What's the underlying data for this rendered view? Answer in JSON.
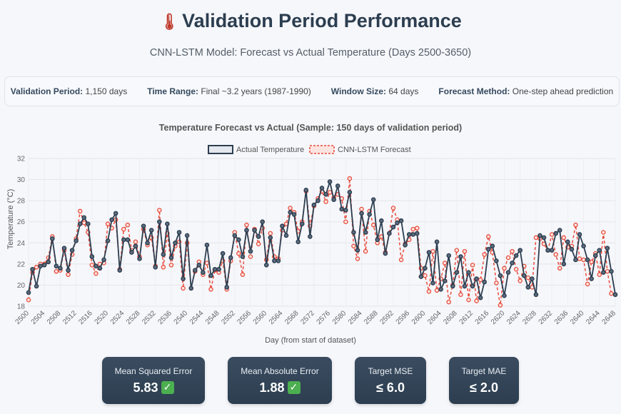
{
  "header": {
    "icon": "thermometer-icon",
    "title": "Validation Period Performance",
    "subtitle": "CNN-LSTM Model: Forecast vs Actual Temperature (Days 2500-3650)"
  },
  "info": {
    "validation_period_label": "Validation Period:",
    "validation_period_value": "1,150 days",
    "time_range_label": "Time Range:",
    "time_range_value": "Final ~3.2 years (1987-1990)",
    "window_size_label": "Window Size:",
    "window_size_value": "64 days",
    "forecast_method_label": "Forecast Method:",
    "forecast_method_value": "One-step ahead prediction"
  },
  "metrics": [
    {
      "label": "Mean Squared Error",
      "value": "5.83",
      "check": "✓"
    },
    {
      "label": "Mean Absolute Error",
      "value": "1.88",
      "check": "✓"
    },
    {
      "label": "Target MSE",
      "value": "≤ 6.0"
    },
    {
      "label": "Target MAE",
      "value": "≤ 2.0"
    }
  ],
  "colors": {
    "actual_line": "#2c3e50",
    "actual_point": "#5d6d7e",
    "forecast": "#e74c3c",
    "card": "#2c3e50",
    "check": "#4caf50"
  },
  "chart_data": {
    "type": "line",
    "title": "Temperature Forecast vs Actual (Sample: 150 days of validation period)",
    "xlabel": "Day (from start of dataset)",
    "ylabel": "Temperature (°C)",
    "ylim": [
      18,
      32
    ],
    "yticks": [
      18,
      20,
      22,
      24,
      26,
      28,
      30,
      32
    ],
    "grid": true,
    "legend": "top-center",
    "x_start": 2500,
    "x_step": 1,
    "xtick_labels": [
      "2500",
      "2504",
      "2508",
      "2512",
      "2516",
      "2520",
      "2524",
      "2528",
      "2532",
      "2536",
      "2540",
      "2544",
      "2548",
      "2552",
      "2556",
      "2560",
      "2564",
      "2568",
      "2572",
      "2576",
      "2580",
      "2584",
      "2588",
      "2592",
      "2596",
      "2600",
      "2604",
      "2608",
      "2612",
      "2616",
      "2620",
      "2624",
      "2628",
      "2632",
      "2636",
      "2640",
      "2644",
      "2648"
    ],
    "series": [
      {
        "name": "Actual Temperature",
        "values": [
          19.3,
          21.5,
          19.9,
          21.8,
          21.9,
          22.2,
          24.4,
          21.8,
          21.6,
          23.5,
          21.4,
          23.3,
          24.2,
          25.8,
          26.4,
          25.8,
          22.7,
          21.8,
          21.6,
          22.4,
          24.2,
          26.2,
          26.8,
          21.4,
          24.3,
          24.3,
          23.1,
          23.7,
          22.5,
          25.6,
          24.0,
          25.2,
          21.7,
          26.0,
          22.9,
          25.8,
          22.6,
          24.0,
          25.0,
          20.6,
          24.7,
          19.7,
          21.4,
          21.9,
          21.2,
          23.8,
          20.9,
          21.5,
          21.5,
          23.0,
          19.8,
          22.6,
          24.7,
          24.3,
          22.7,
          25.2,
          23.2,
          25.2,
          24.6,
          26.0,
          21.9,
          24.5,
          22.3,
          22.3,
          25.6,
          24.7,
          26.9,
          26.7,
          24.1,
          25.8,
          29.0,
          24.6,
          27.6,
          28.0,
          29.2,
          28.6,
          29.8,
          28.1,
          29.4,
          27.2,
          27.1,
          28.8,
          25.0,
          23.3,
          26.8,
          25.0,
          26.7,
          28.1,
          24.3,
          26.1,
          23.0,
          24.9,
          25.5,
          25.9,
          26.1,
          23.8,
          24.8,
          24.8,
          24.9,
          20.8,
          21.6,
          23.1,
          20.2,
          24.1,
          19.6,
          20.4,
          22.8,
          19.9,
          21.2,
          22.7,
          19.9,
          21.2,
          19.9,
          20.6,
          18.8,
          20.3,
          23.4,
          23.7,
          22.3,
          20.9,
          19.0,
          21.2,
          22.1,
          22.8,
          23.3,
          20.9,
          19.8,
          20.6,
          19.1,
          24.7,
          24.5,
          23.3,
          23.3,
          24.9,
          25.2,
          22.0,
          24.1,
          23.4,
          22.4,
          24.8,
          23.7,
          22.4,
          20.6,
          22.8,
          23.3,
          21.2,
          23.5,
          21.3,
          19.1
        ]
      },
      {
        "name": "CNN-LSTM Forecast",
        "values": [
          18.6,
          21.2,
          21.7,
          22.0,
          22.0,
          22.6,
          24.6,
          21.3,
          21.4,
          23.3,
          21.0,
          22.9,
          24.4,
          27.0,
          25.9,
          25.0,
          21.9,
          21.1,
          22.0,
          22.1,
          25.8,
          25.4,
          26.2,
          21.5,
          25.3,
          25.7,
          23.3,
          24.1,
          22.7,
          25.3,
          23.8,
          24.5,
          21.8,
          27.1,
          21.7,
          24.9,
          21.9,
          23.7,
          24.1,
          19.7,
          24.0,
          19.7,
          21.3,
          22.2,
          21.0,
          22.1,
          19.6,
          21.4,
          21.2,
          22.3,
          19.6,
          22.3,
          25.0,
          23.0,
          21.0,
          25.7,
          22.7,
          25.3,
          23.9,
          25.4,
          22.4,
          24.9,
          22.7,
          22.5,
          25.2,
          25.8,
          27.3,
          26.9,
          25.1,
          26.0,
          28.9,
          25.6,
          27.5,
          28.2,
          28.9,
          27.9,
          28.8,
          28.3,
          28.6,
          28.2,
          26.0,
          30.1,
          23.7,
          22.5,
          27.2,
          23.2,
          27.0,
          25.7,
          24.0,
          24.6,
          23.1,
          24.9,
          27.3,
          26.2,
          22.4,
          23.9,
          24.3,
          25.3,
          25.4,
          21.6,
          20.9,
          19.4,
          23.2,
          19.5,
          20.6,
          22.1,
          18.4,
          20.0,
          23.3,
          19.1,
          23.2,
          18.6,
          21.9,
          18.5,
          20.5,
          22.9,
          24.6,
          23.1,
          20.2,
          18.1,
          21.6,
          22.6,
          23.2,
          21.5,
          20.4,
          21.8,
          20.7,
          19.8,
          24.5,
          24.4,
          23.9,
          23.3,
          24.8,
          22.9,
          21.6,
          24.5,
          23.6,
          23.7,
          25.7,
          22.5,
          22.4,
          20.1,
          22.2,
          23.0,
          21.0,
          25.0,
          21.3,
          19.2
        ]
      }
    ]
  }
}
